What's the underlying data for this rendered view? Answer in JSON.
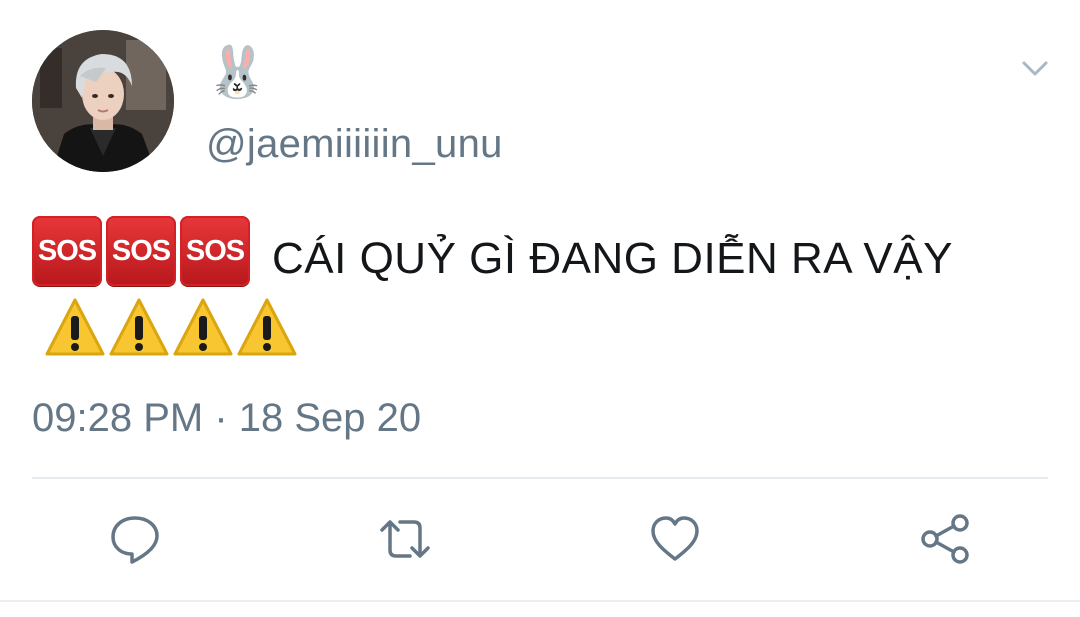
{
  "tweet": {
    "display_name": "🐰",
    "handle": "@jaemiiiiiin_unu",
    "emoji_prefix": [
      "SOS",
      "SOS",
      "SOS"
    ],
    "text": "CÁI QUỶ GÌ ĐANG DIỄN RA VẬY",
    "emoji_suffix": [
      "⚠️",
      "⚠️",
      "⚠️",
      "⚠️"
    ],
    "timestamp": "09:28 PM · 18 Sep 20"
  },
  "icons": {
    "menu": "chevron-down-icon",
    "reply": "reply-icon",
    "retweet": "retweet-icon",
    "like": "heart-icon",
    "share": "share-icon"
  },
  "colors": {
    "text": "#14171a",
    "secondary": "#657786",
    "divider": "#e6ecf0",
    "sos_red": "#d42125",
    "warning_yellow": "#f7c631"
  }
}
